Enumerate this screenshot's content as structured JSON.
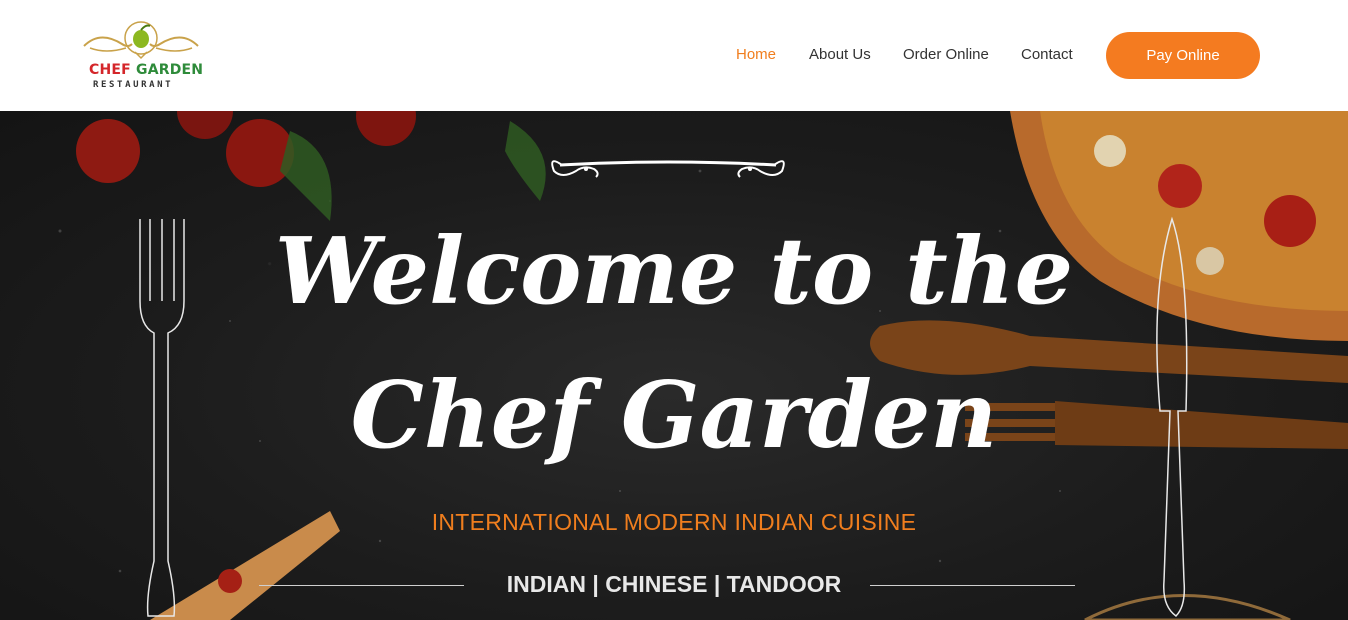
{
  "brand": {
    "logo_word_1": "CHEF",
    "logo_word_2": "GARDEN",
    "logo_subtitle": "RESTAURANT",
    "colors": {
      "chef": "#d4262a",
      "garden": "#2e8b3a"
    }
  },
  "nav": {
    "items": [
      {
        "label": "Home",
        "active": true
      },
      {
        "label": "About Us",
        "active": false
      },
      {
        "label": "Order Online",
        "active": false
      },
      {
        "label": "Contact",
        "active": false
      }
    ],
    "cta_label": "Pay Online"
  },
  "hero": {
    "title_line_1": "Welcome to the",
    "title_line_2": "Chef Garden",
    "subtitle": "INTERNATIONAL MODERN INDIAN CUISINE",
    "cuisines": "INDIAN | CHINESE | TANDOOR"
  },
  "colors": {
    "accent": "#f47b20",
    "nav_active": "#f07e1e",
    "hero_bg": "#1c1c1c"
  },
  "icons": [
    "logo-emblem",
    "fork-outline-icon",
    "knife-outline-icon",
    "ornament-divider-icon"
  ]
}
